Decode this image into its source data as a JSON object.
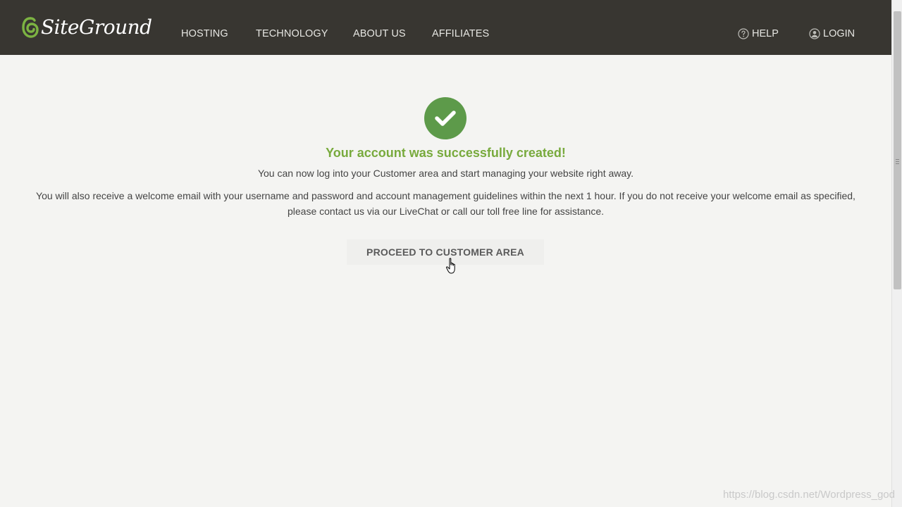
{
  "header": {
    "brand": "SiteGround",
    "nav": [
      {
        "label": "HOSTING"
      },
      {
        "label": "TECHNOLOGY"
      },
      {
        "label": "ABOUT US"
      },
      {
        "label": "AFFILIATES"
      }
    ],
    "help_label": "HELP",
    "login_label": "LOGIN"
  },
  "main": {
    "title": "Your account was successfully created!",
    "lead": "You can now log into your Customer area and start managing your website right away.",
    "info": "You will also receive a welcome email with your username and password and account management guidelines within the next 1 hour. If you do not receive your welcome email as specified, please contact us via our LiveChat or call our toll free line for assistance.",
    "proceed_label": "PROCEED TO CUSTOMER AREA"
  },
  "watermark": "https://blog.csdn.net/Wordpress_god",
  "colors": {
    "header_bg": "#383631",
    "page_bg": "#f4f4f2",
    "success_green": "#5d9a4a",
    "title_green": "#78aa3d",
    "logo_green": "#7cb342"
  },
  "icons": {
    "logo": "siteground-swirl-icon",
    "success": "checkmark-icon",
    "help": "question-circle-icon",
    "login": "user-circle-icon",
    "cursor": "hand-pointer-icon"
  }
}
